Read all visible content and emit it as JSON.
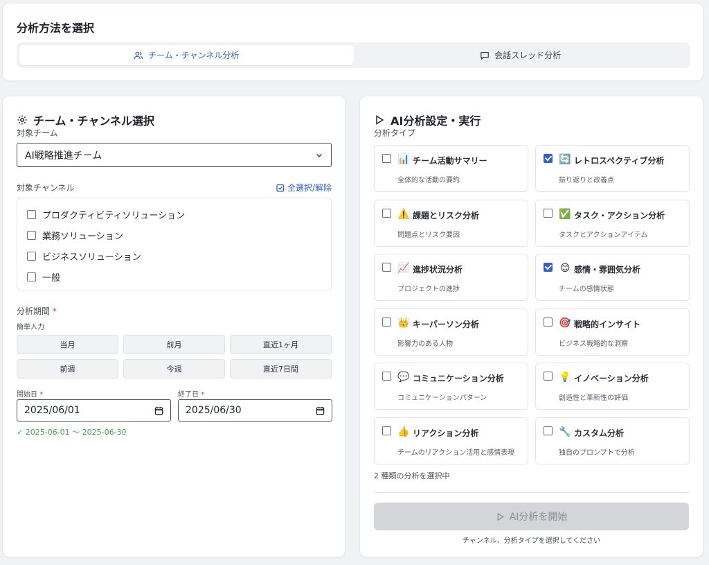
{
  "method": {
    "title": "分析方法を選択",
    "tabs": [
      {
        "label": "チーム・チャンネル分析",
        "active": true
      },
      {
        "label": "会話スレッド分析",
        "active": false
      }
    ]
  },
  "left": {
    "title": "チーム・チャンネル選択",
    "team_label": "対象チーム",
    "team_value": "AI戦略推進チーム",
    "channel_label": "対象チャンネル",
    "toggle_all": "全選択/解除",
    "channels": [
      {
        "label": "プロダクティビティソリューション",
        "checked": false
      },
      {
        "label": "業務ソリューション",
        "checked": false
      },
      {
        "label": "ビジネスソリューション",
        "checked": false
      },
      {
        "label": "一般",
        "checked": false
      }
    ],
    "period_label": "分析期間",
    "required_mark": "*",
    "quick_label": "簡単入力",
    "quick_buttons": [
      "当月",
      "前月",
      "直近1ヶ月",
      "前週",
      "今週",
      "直近7日間"
    ],
    "start_label": "開始日",
    "start_value": "2025/06/01",
    "end_label": "終了日",
    "end_value": "2025/06/30",
    "range_note": "✓ 2025-06-01 〜 2025-06-30"
  },
  "right": {
    "title": "AI分析設定・実行",
    "type_label": "分析タイプ",
    "types": [
      {
        "icon": "📊",
        "name": "チーム活動サマリー",
        "desc": "全体的な活動の要約",
        "checked": false
      },
      {
        "icon": "🔄",
        "name": "レトロスペクティブ分析",
        "desc": "振り返りと改善点",
        "checked": true
      },
      {
        "icon": "⚠️",
        "name": "課題とリスク分析",
        "desc": "問題点とリスク要因",
        "checked": false
      },
      {
        "icon": "✅",
        "name": "タスク・アクション分析",
        "desc": "タスクとアクションアイテム",
        "checked": false
      },
      {
        "icon": "📈",
        "name": "進捗状況分析",
        "desc": "プロジェクトの進捗",
        "checked": false
      },
      {
        "icon": "😊",
        "name": "感情・雰囲気分析",
        "desc": "チームの感情状態",
        "checked": true
      },
      {
        "icon": "👑",
        "name": "キーパーソン分析",
        "desc": "影響力のある人物",
        "checked": false
      },
      {
        "icon": "🎯",
        "name": "戦略的インサイト",
        "desc": "ビジネス戦略的な洞察",
        "checked": false
      },
      {
        "icon": "💬",
        "name": "コミュニケーション分析",
        "desc": "コミュニケーションパターン",
        "checked": false
      },
      {
        "icon": "💡",
        "name": "イノベーション分析",
        "desc": "創造性と革新性の評価",
        "checked": false
      },
      {
        "icon": "👍",
        "name": "リアクション分析",
        "desc": "チームのリアクション活用と感情表現",
        "checked": false
      },
      {
        "icon": "🔧",
        "name": "カスタム分析",
        "desc": "独自のプロンプトで分析",
        "checked": false
      }
    ],
    "selected_count": "2 種類の分析を選択中",
    "start_button": "AI分析を開始",
    "hint": "チャンネル、分析タイプを選択してください"
  }
}
